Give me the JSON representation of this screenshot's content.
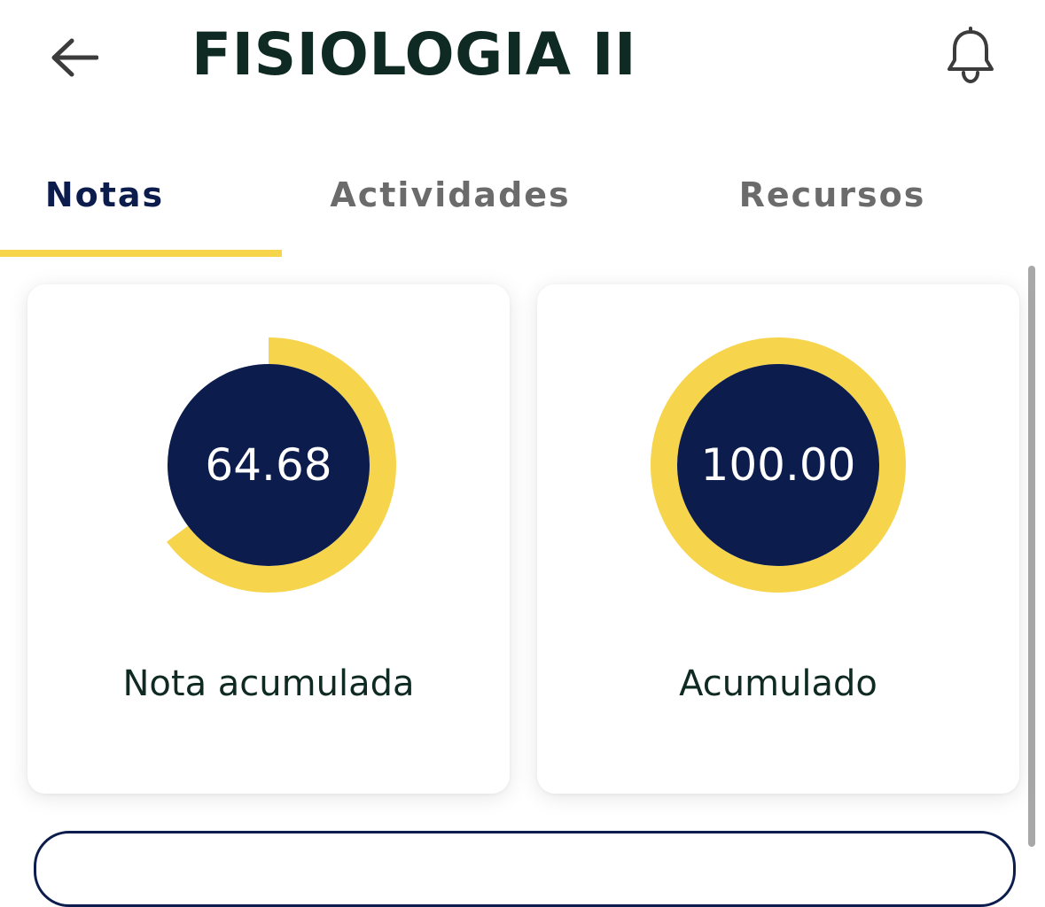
{
  "header": {
    "title": "FISIOLOGIA II",
    "back_icon": "arrow-left-icon",
    "notification_icon": "bell-icon"
  },
  "tabs": [
    {
      "label": "Notas",
      "active": true
    },
    {
      "label": "Actividades",
      "active": false
    },
    {
      "label": "Recursos",
      "active": false
    }
  ],
  "cards": [
    {
      "value": "64.68",
      "progress": 0.6468,
      "label": "Nota acumulada"
    },
    {
      "value": "100.00",
      "progress": 1.0,
      "label": "Acumulado"
    }
  ],
  "colors": {
    "accent": "#f6d44c",
    "primary_navy": "#0b1c4d",
    "text_dark": "#0f2a22",
    "tab_inactive": "#6b6b6b"
  }
}
